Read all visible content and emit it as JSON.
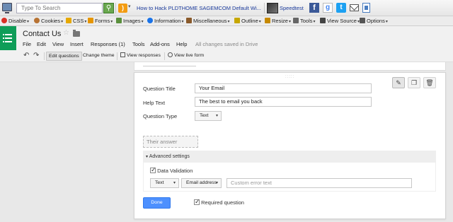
{
  "browser_toolbar": {
    "search_placeholder": "Type To Search",
    "bookmark_link": "How to Hack PLDTHOME SAGEMCOM Default Wi...",
    "speedtest_link": "Speedtest"
  },
  "webdev_toolbar": {
    "items": [
      {
        "label": "Disable",
        "icon": "disable-icon",
        "color": "#d93025"
      },
      {
        "label": "Cookies",
        "icon": "cookie-icon",
        "color": "#b87333"
      },
      {
        "label": "CSS",
        "icon": "css-icon",
        "color": "#e6a800"
      },
      {
        "label": "Forms",
        "icon": "forms-icon",
        "color": "#e69500"
      },
      {
        "label": "Images",
        "icon": "images-icon",
        "color": "#5a8f3c"
      },
      {
        "label": "Information",
        "icon": "info-icon",
        "color": "#1a73e8"
      },
      {
        "label": "Miscellaneous",
        "icon": "misc-icon",
        "color": "#8a5a2b"
      },
      {
        "label": "Outline",
        "icon": "outline-icon",
        "color": "#c6a700"
      },
      {
        "label": "Resize",
        "icon": "resize-icon",
        "color": "#c68900"
      },
      {
        "label": "Tools",
        "icon": "tools-icon",
        "color": "#666666"
      },
      {
        "label": "View Source",
        "icon": "source-icon",
        "color": "#444444"
      },
      {
        "label": "Options",
        "icon": "options-icon",
        "color": "#555555"
      }
    ]
  },
  "doc": {
    "title": "Contact  Us",
    "saved_status": "All changes saved in Drive",
    "menu": [
      "File",
      "Edit",
      "View",
      "Insert",
      "Responses (1)",
      "Tools",
      "Add-ons",
      "Help"
    ]
  },
  "toolbar": {
    "edit_questions": "Edit questions",
    "change_theme": "Change theme",
    "view_responses": "View responses",
    "view_live_form": "View live form"
  },
  "question": {
    "title_label": "Question Title",
    "title_value": "Your Email",
    "help_label": "Help Text",
    "help_value": "The best to email you back",
    "type_label": "Question Type",
    "type_value": "Text",
    "answer_placeholder": "Their answer",
    "advanced_label": "Advanced settings",
    "validation_label": "Data Validation",
    "validation_type": "Text",
    "validation_rule": "Email address",
    "error_placeholder": "Custom error text",
    "done_label": "Done",
    "required_label": "Required question"
  },
  "colors": {
    "forms_green": "#0f9d58",
    "done_blue": "#4d90fe",
    "link_blue": "#1a3a9c"
  }
}
